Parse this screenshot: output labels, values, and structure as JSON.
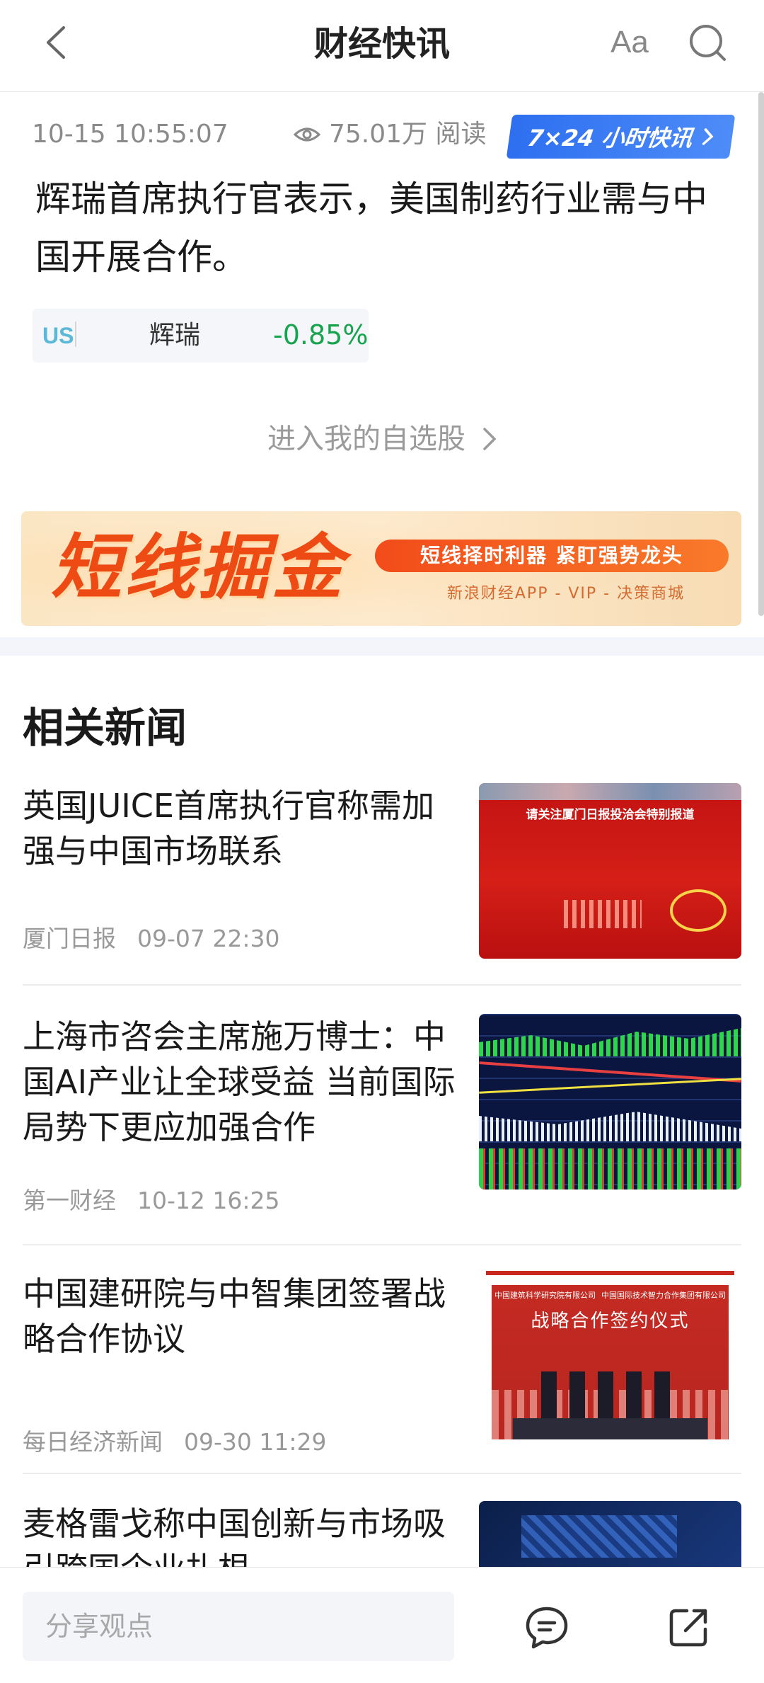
{
  "header": {
    "title": "财经快讯",
    "font_size_label": "Aa"
  },
  "flash": {
    "timestamp": "10-15 10:55:07",
    "views": "75.01万 阅读",
    "badge_label": "7×24 小时快讯",
    "headline": "辉瑞首席执行官表示，美国制药行业需与中国开展合作。",
    "stock": {
      "market": "US",
      "name": "辉瑞",
      "change": "-0.85%"
    },
    "my_stocks_link": "进入我的自选股"
  },
  "banner": {
    "title": "短线掘金",
    "pill": "短线择时利器  紧盯强势龙头",
    "subtitle": "新浪财经APP - VIP - 决策商城"
  },
  "related": {
    "section_title": "相关新闻",
    "items": [
      {
        "title": "英国JUICE首席执行官称需加强与中国市场联系",
        "source": "厦门日报",
        "time": "09-07 22:30",
        "thumb_caption": "请关注厦门日报投洽会特别报道"
      },
      {
        "title": "上海市咨会主席施万博士：中国AI产业让全球受益 当前国际局势下更应加强合作",
        "source": "第一财经",
        "time": "10-12 16:25"
      },
      {
        "title": "中国建研院与中智集团签署战略合作协议",
        "source": "每日经济新闻",
        "time": "09-30 11:29",
        "thumb_caption": "战略合作签约仪式",
        "thumb_org_left": "中国建筑科学研究院有限公司",
        "thumb_org_right": "中国国际技术智力合作集团有限公司"
      },
      {
        "title": "麦格雷戈称中国创新与市场吸引跨国企业扎根",
        "source": "",
        "time": ""
      }
    ]
  },
  "bottom_bar": {
    "comment_placeholder": "分享观点"
  },
  "colors": {
    "accent_blue": "#2d6ff0",
    "down_green": "#18a34f",
    "banner_orange": "#ee4a14",
    "market_tag": "#5bb8d8"
  }
}
